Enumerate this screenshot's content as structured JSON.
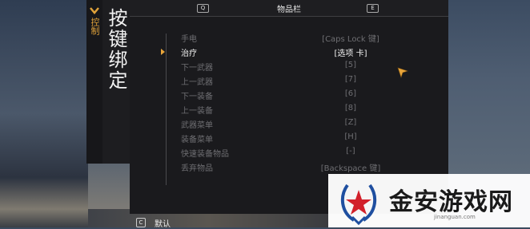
{
  "side_tab": {
    "label": "控制"
  },
  "page_title": "按键绑定",
  "topbar": {
    "left_key": "Q",
    "title": "物品栏",
    "right_key": "E"
  },
  "bindings": [
    {
      "action": "手电",
      "key": "[Caps Lock 键]"
    },
    {
      "action": "治疗",
      "key": "[选项 卡]"
    },
    {
      "action": "下一武器",
      "key": "[5]"
    },
    {
      "action": "上一武器",
      "key": "[7]"
    },
    {
      "action": "下一装备",
      "key": "[6]"
    },
    {
      "action": "上一装备",
      "key": "[8]"
    },
    {
      "action": "武器菜单",
      "key": "[Z]"
    },
    {
      "action": "装备菜单",
      "key": "[H]"
    },
    {
      "action": "快速装备物品",
      "key": "[-]"
    },
    {
      "action": "丢弃物品",
      "key": "[Backspace 键]"
    }
  ],
  "selected_index": 1,
  "bottom_hint": {
    "key": "C",
    "label": "默认"
  },
  "watermark": {
    "brand": "金安游戏网",
    "url": "jinanguan.com"
  },
  "colors": {
    "accent": "#e8a53a",
    "inactive_text": "#6e6e72",
    "active_text": "#f2f2f2"
  }
}
